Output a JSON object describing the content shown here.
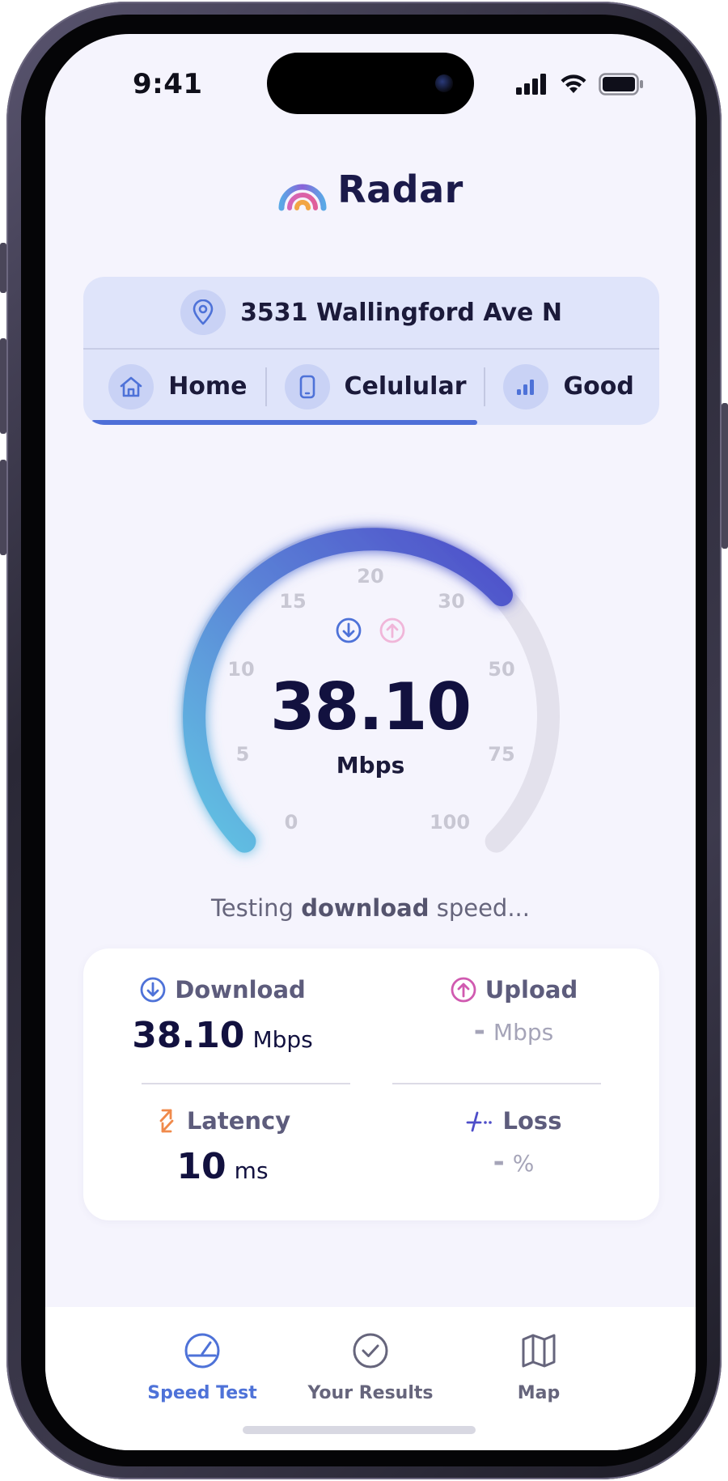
{
  "status": {
    "time": "9:41"
  },
  "brand": {
    "name": "Radar"
  },
  "location": {
    "address": "3531 Wallingford Ave N",
    "chips": [
      {
        "icon": "home-icon",
        "label": "Home"
      },
      {
        "icon": "phone-icon",
        "label": "Celulular"
      },
      {
        "icon": "signal-bars-icon",
        "label": "Good"
      }
    ],
    "progress_fraction": 0.69
  },
  "gauge": {
    "value": "38.10",
    "unit": "Mbps",
    "current": 38.1,
    "ticks": [
      "0",
      "5",
      "10",
      "15",
      "20",
      "30",
      "50",
      "75",
      "100"
    ],
    "colors": {
      "start": "#62c4e3",
      "end": "#4e4ec9",
      "track": "#e3e1ec"
    }
  },
  "testing": {
    "prefix": "Testing ",
    "bold": "download",
    "suffix": " speed..."
  },
  "results": {
    "download": {
      "label": "Download",
      "value": "38.10",
      "unit": "Mbps",
      "color": "#4e72d8"
    },
    "upload": {
      "label": "Upload",
      "value": "-",
      "unit": "Mbps",
      "color": "#d05ab0"
    },
    "latency": {
      "label": "Latency",
      "value": "10",
      "unit": "ms",
      "color": "#f08a4b"
    },
    "loss": {
      "label": "Loss",
      "value": "-",
      "unit": "%",
      "color": "#4e4ec9"
    }
  },
  "tabs": [
    {
      "label": "Speed Test",
      "icon": "speedometer-icon",
      "active": true
    },
    {
      "label": "Your Results",
      "icon": "check-circle-icon",
      "active": false
    },
    {
      "label": "Map",
      "icon": "map-icon",
      "active": false
    }
  ]
}
